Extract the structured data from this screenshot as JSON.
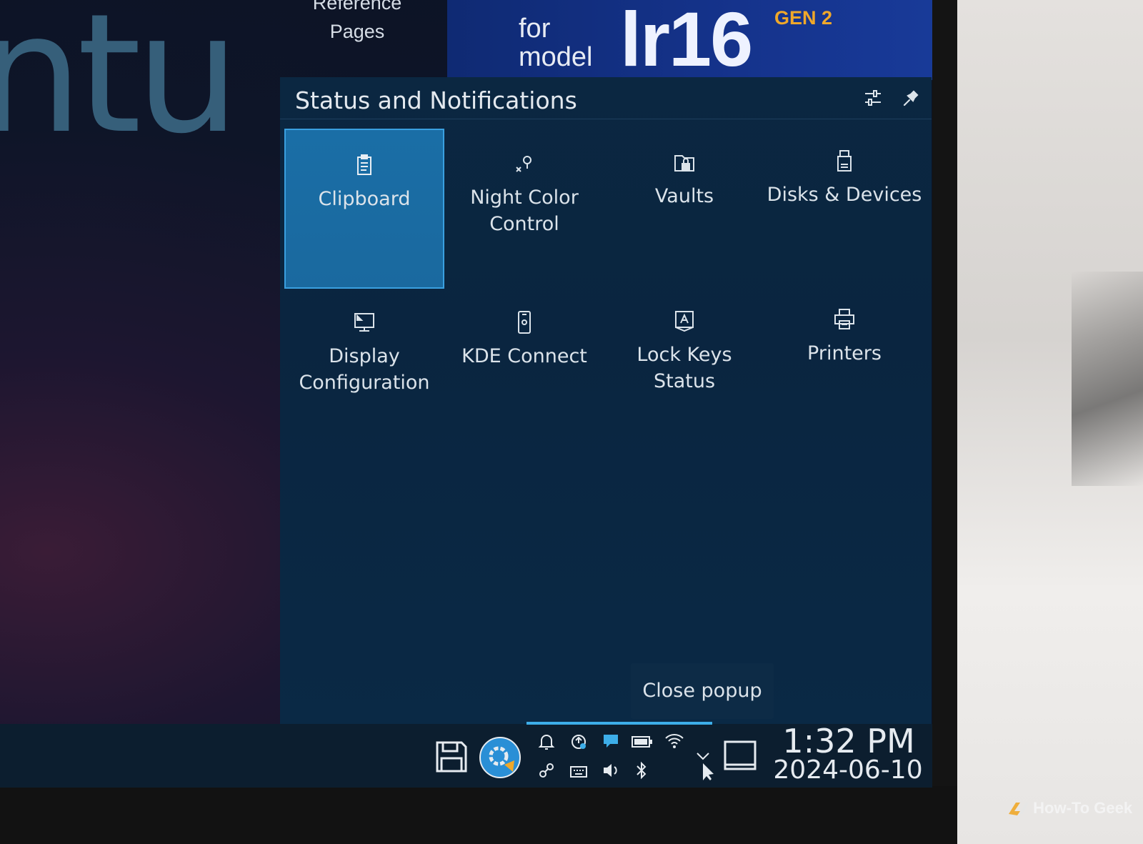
{
  "wallpaper": {
    "brand_fragment": "ntu",
    "reference_line1": "Reference",
    "reference_line2": "Pages",
    "banner_for": "for",
    "banner_model": "model",
    "banner_model_name": "lr16",
    "banner_gen": "GEN 2"
  },
  "popup": {
    "title": "Status and Notifications",
    "configure_icon": "sliders-icon",
    "pin_icon": "pin-icon",
    "items": [
      {
        "label_line1": "Clipboard",
        "label_line2": "",
        "icon": "clipboard-icon",
        "selected": true
      },
      {
        "label_line1": "Night Color",
        "label_line2": "Control",
        "icon": "night-color-icon",
        "selected": false
      },
      {
        "label_line1": "Vaults",
        "label_line2": "",
        "icon": "vault-icon",
        "selected": false
      },
      {
        "label_line1": "Disks & Devices",
        "label_line2": "",
        "icon": "usb-drive-icon",
        "selected": false
      },
      {
        "label_line1": "Display",
        "label_line2": "Configuration",
        "icon": "monitor-icon",
        "selected": false
      },
      {
        "label_line1": "KDE Connect",
        "label_line2": "",
        "icon": "phone-icon",
        "selected": false
      },
      {
        "label_line1": "Lock Keys Status",
        "label_line2": "",
        "icon": "keyboard-lock-icon",
        "selected": false
      },
      {
        "label_line1": "Printers",
        "label_line2": "",
        "icon": "printer-icon",
        "selected": false
      }
    ],
    "close_popup_label": "Close popup"
  },
  "taskbar": {
    "time": "1:32 PM",
    "date": "2024-06-10",
    "tray_icons": [
      "save-icon",
      "kde-discover-icon",
      "bell-icon",
      "updates-icon",
      "notifications-chat-icon",
      "battery-icon",
      "wifi-icon",
      "expand-tray-icon",
      "clipboard-tray-icon",
      "keyboard-icon",
      "volume-icon",
      "bluetooth-icon",
      "show-desktop-icon"
    ]
  },
  "watermark": "How-To Geek",
  "colors": {
    "accent": "#3daee9",
    "selected_tile": "#1a6ea6",
    "popup_bg": "#0a2540",
    "gen_badge": "#f0a82a"
  }
}
